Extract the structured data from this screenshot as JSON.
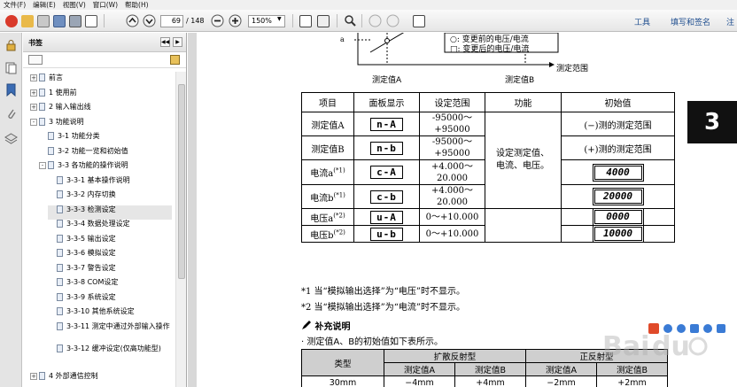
{
  "menu": [
    "文件(F)",
    "编辑(E)",
    "视图(V)",
    "窗口(W)",
    "帮助(H)"
  ],
  "toolbar": {
    "current_page": "69",
    "total_pages": "/ 148",
    "zoom": "150%",
    "tools_label": "工具",
    "sign_label": "填写和签名",
    "comment_label": "注"
  },
  "bookmarks": {
    "title": "书签",
    "items": [
      {
        "label": "前言",
        "level": 0,
        "expander": "+"
      },
      {
        "label": "1  使用前",
        "level": 0,
        "expander": "+"
      },
      {
        "label": "2  输入输出线",
        "level": 0,
        "expander": "+"
      },
      {
        "label": "3  功能说明",
        "level": 0,
        "expander": "-"
      },
      {
        "label": "3-1  功能分类",
        "level": 1,
        "expander": ""
      },
      {
        "label": "3-2  功能一览和初始值",
        "level": 1,
        "expander": ""
      },
      {
        "label": "3-3  各功能的操作说明",
        "level": 1,
        "expander": "-"
      },
      {
        "label": "3-3-1  基本操作说明",
        "level": 2,
        "expander": ""
      },
      {
        "label": "3-3-2  内存切换",
        "level": 2,
        "expander": ""
      },
      {
        "label": "3-3-3  检测设定",
        "level": 2,
        "expander": "",
        "selected": true
      },
      {
        "label": "3-3-4  数据处理设定",
        "level": 2,
        "expander": ""
      },
      {
        "label": "3-3-5  输出设定",
        "level": 2,
        "expander": ""
      },
      {
        "label": "3-3-6  模拟设定",
        "level": 2,
        "expander": ""
      },
      {
        "label": "3-3-7  警告设定",
        "level": 2,
        "expander": ""
      },
      {
        "label": "3-3-8  COM设定",
        "level": 2,
        "expander": ""
      },
      {
        "label": "3-3-9  系统设定",
        "level": 2,
        "expander": ""
      },
      {
        "label": "3-3-10  其他系统设定",
        "level": 2,
        "expander": ""
      },
      {
        "label": "3-3-11  测定中通过外部输入操作",
        "level": 2,
        "expander": ""
      },
      {
        "label": "3-3-12  缓冲设定(仅高功能型)",
        "level": 2,
        "expander": ""
      },
      {
        "label": "4  外部通信控制",
        "level": 0,
        "expander": "+"
      }
    ]
  },
  "diagram": {
    "axis_a": "a",
    "legend_before": "○: 变更前的电压/电流",
    "legend_after": "□: 变更后的电压/电流",
    "label_a": "测定值A",
    "label_b": "测定值B",
    "label_range": "测定范围"
  },
  "spec_table": {
    "headers": [
      "项目",
      "面板显示",
      "设定范围",
      "功能",
      "初始值"
    ],
    "function_text": "设定测定值、电流、电压。",
    "rows": [
      {
        "item": "测定值A",
        "note": "",
        "panel": "n-A",
        "range1": "-95000～",
        "range2": "+95000",
        "init": "(−)测的测定范围",
        "lcd": false
      },
      {
        "item": "测定值B",
        "note": "",
        "panel": "n-b",
        "range1": "-95000～",
        "range2": "+95000",
        "init": "(+)测的测定范围",
        "lcd": false
      },
      {
        "item": "电流a",
        "note": "(*1)",
        "panel": "c-A",
        "range1": "+4.000～",
        "range2": "20.000",
        "init": "4000",
        "lcd": true
      },
      {
        "item": "电流b",
        "note": "(*1)",
        "panel": "c-b",
        "range1": "+4.000～",
        "range2": "20.000",
        "init": "20000",
        "lcd": true
      },
      {
        "item": "电压a",
        "note": "(*2)",
        "panel": "u-A",
        "range1": "0～+10.000",
        "range2": "",
        "init": "0000",
        "lcd": true
      },
      {
        "item": "电压b",
        "note": "(*2)",
        "panel": "u-b",
        "range1": "0～+10.000",
        "range2": "",
        "init": "10000",
        "lcd": true
      }
    ]
  },
  "notes": {
    "n1": "*1 当“模拟输出选择”为“电压”时不显示。",
    "n2": "*2 当“模拟输出选择”为“电流”时不显示。",
    "supplement_title": "补充说明",
    "supplement_text": "· 测定值A、B的初始值如下表所示。"
  },
  "init_table": {
    "type_header": "类型",
    "group1": "扩散反射型",
    "group2": "正反射型",
    "sub": [
      "测定值A",
      "测定值B",
      "测定值A",
      "测定值B"
    ],
    "row1": [
      "30mm",
      "−4mm",
      "+4mm",
      "−2mm",
      "+2mm"
    ]
  },
  "section_tab": "3",
  "colors": {
    "accent": "#1f4e8f",
    "tab_bg": "#111111"
  }
}
